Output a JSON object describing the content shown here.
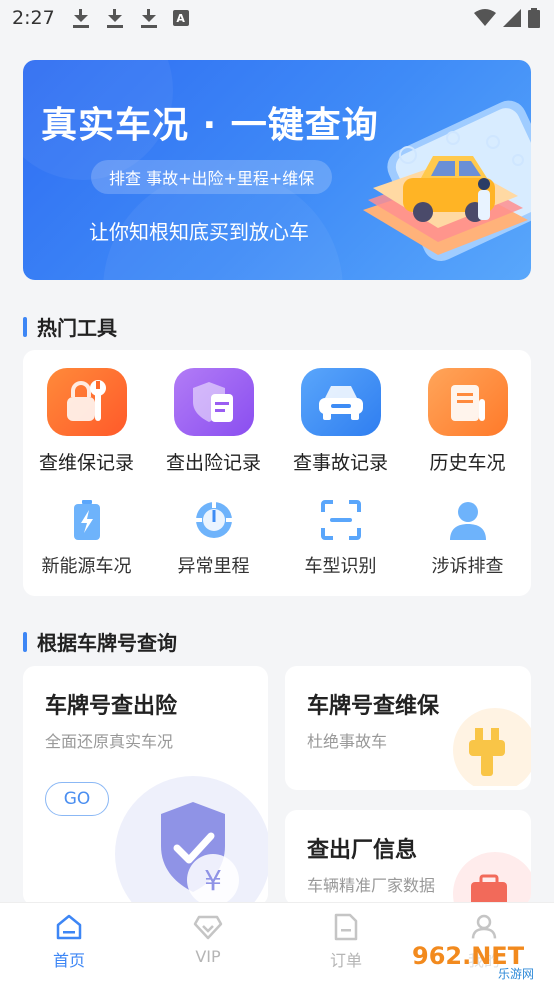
{
  "status_bar": {
    "time": "2:27",
    "badge_letter": "A"
  },
  "banner": {
    "title": "真实车况 · 一键查询",
    "pill_text": "排查 事故+出险+里程+维保",
    "slogan": "让你知根知底买到放心车"
  },
  "hot_tools": {
    "section_title": "热门工具",
    "primary": [
      {
        "label": "查维保记录",
        "icon": "wrench-lock-icon",
        "color": "#ff6a2b"
      },
      {
        "label": "查出险记录",
        "icon": "shield-doc-icon",
        "color": "#9a5df2"
      },
      {
        "label": "查事故记录",
        "icon": "car-icon",
        "color": "#3d8cf5"
      },
      {
        "label": "历史车况",
        "icon": "scroll-icon",
        "color": "#ff8a3d"
      }
    ],
    "secondary": [
      {
        "label": "新能源车况",
        "icon": "battery-icon"
      },
      {
        "label": "异常里程",
        "icon": "speedometer-icon"
      },
      {
        "label": "车型识别",
        "icon": "scan-car-icon"
      },
      {
        "label": "涉诉排查",
        "icon": "person-icon"
      }
    ]
  },
  "plate_query": {
    "section_title": "根据车牌号查询",
    "insurance_card": {
      "title": "车牌号查出险",
      "subtitle": "全面还原真实车况",
      "go_label": "GO",
      "icon": "shield-yen-icon"
    },
    "maintenance_card": {
      "title": "车牌号查维保",
      "subtitle": "杜绝事故车",
      "icon": "wrench-icon"
    },
    "factory_card": {
      "title": "查出厂信息",
      "subtitle": "车辆精准厂家数据",
      "icon": "toolbox-icon"
    }
  },
  "tabbar": {
    "tabs": [
      {
        "label": "首页",
        "icon": "home-icon",
        "active": true
      },
      {
        "label": "VIP",
        "icon": "diamond-icon",
        "active": false
      },
      {
        "label": "订单",
        "icon": "document-icon",
        "active": false
      },
      {
        "label": "我的",
        "icon": "user-icon",
        "active": false
      }
    ]
  },
  "watermark": {
    "text": "962.NET",
    "sub": "乐游网"
  }
}
